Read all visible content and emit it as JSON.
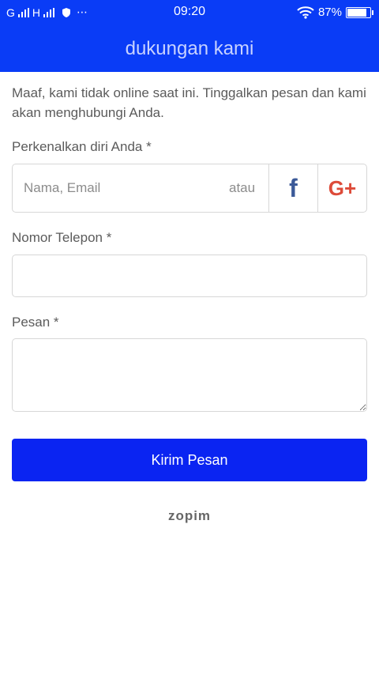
{
  "status_bar": {
    "sim1_label": "G",
    "sim2_label": "H",
    "more": "⋯",
    "time": "09:20",
    "battery_text": "87%",
    "battery_level": 0.87,
    "icons": [
      "signal-icon",
      "shield-icon",
      "wifi-icon",
      "battery-icon"
    ]
  },
  "header": {
    "title": "dukungan kami"
  },
  "intro": "Maaf, kami tidak online saat ini. Tinggalkan pesan dan kami akan menghubungi Anda.",
  "intro_field": {
    "label": "Perkenalkan diri Anda *",
    "placeholder": "Nama, Email",
    "or_text": "atau",
    "facebook_glyph": "f",
    "google_glyph": "G+"
  },
  "phone_field": {
    "label": "Nomor Telepon *",
    "value": ""
  },
  "message_field": {
    "label": "Pesan *",
    "value": ""
  },
  "submit_label": "Kirim Pesan",
  "footer_brand": "zopim",
  "colors": {
    "primary": "#0a3cf6",
    "button": "#0a24f2",
    "facebook": "#3b5998",
    "google": "#dd4b39"
  }
}
